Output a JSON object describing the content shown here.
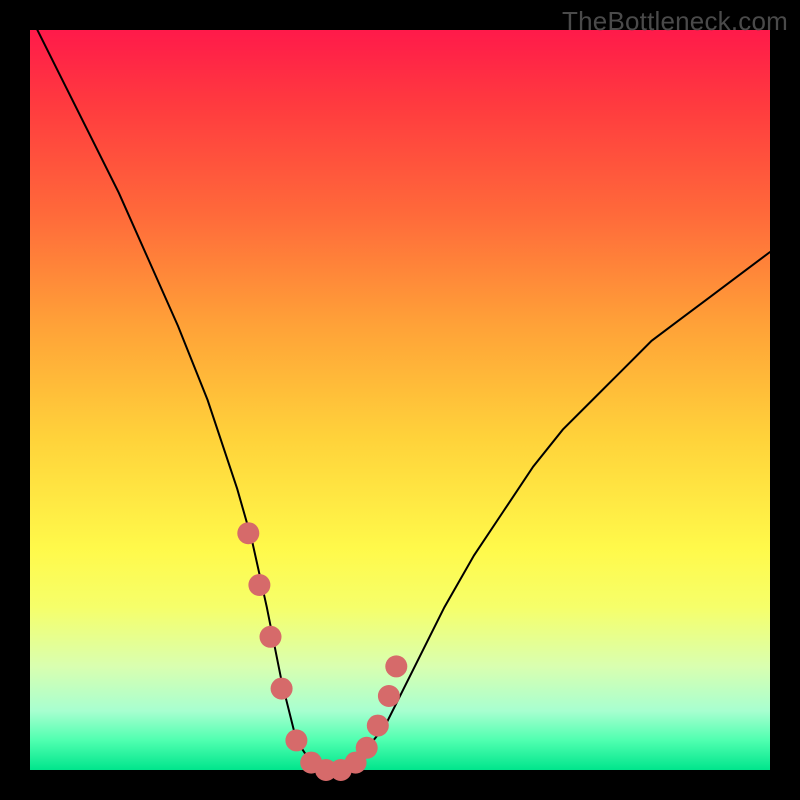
{
  "watermark": "TheBottleneck.com",
  "colors": {
    "background": "#000000",
    "gradient_top": "#ff1a4a",
    "gradient_bottom": "#00e58c",
    "curve": "#000000",
    "marker": "#d66a6a"
  },
  "chart_data": {
    "type": "line",
    "title": "",
    "xlabel": "",
    "ylabel": "",
    "xlim": [
      0,
      100
    ],
    "ylim": [
      0,
      100
    ],
    "x": [
      0,
      4,
      8,
      12,
      16,
      20,
      24,
      28,
      30,
      32,
      34,
      36,
      38,
      40,
      42,
      44,
      48,
      52,
      56,
      60,
      64,
      68,
      72,
      76,
      80,
      84,
      88,
      92,
      96,
      100
    ],
    "y": [
      102,
      94,
      86,
      78,
      69,
      60,
      50,
      38,
      31,
      22,
      12,
      4,
      1,
      0,
      0,
      1,
      6,
      14,
      22,
      29,
      35,
      41,
      46,
      50,
      54,
      58,
      61,
      64,
      67,
      70
    ],
    "markers_x": [
      29.5,
      31.0,
      32.5,
      34.0,
      36.0,
      38.0,
      40.0,
      42.0,
      44.0,
      45.5,
      47.0,
      48.5,
      49.5
    ],
    "markers_y": [
      32,
      25,
      18,
      11,
      4,
      1,
      0,
      0,
      1,
      3,
      6,
      10,
      14
    ],
    "annotations": []
  }
}
